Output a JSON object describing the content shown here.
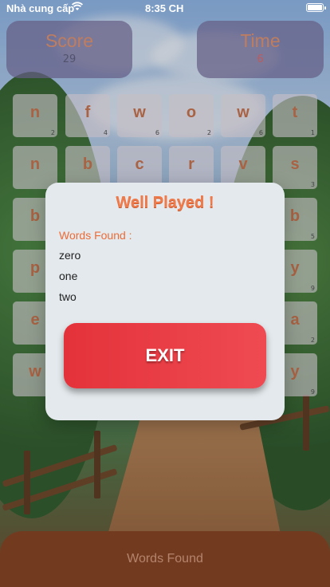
{
  "status_bar": {
    "carrier": "Nhà cung cấp",
    "time": "8:35 CH"
  },
  "score": {
    "label": "Score",
    "value": "29"
  },
  "time": {
    "label": "Time",
    "value": "6"
  },
  "grid": {
    "rows": [
      [
        {
          "l": "n",
          "n": "2"
        },
        {
          "l": "f",
          "n": "4"
        },
        {
          "l": "w",
          "n": "6"
        },
        {
          "l": "o",
          "n": "2"
        },
        {
          "l": "w",
          "n": "6"
        },
        {
          "l": "t",
          "n": "1"
        }
      ],
      [
        {
          "l": "n",
          "n": ""
        },
        {
          "l": "b",
          "n": ""
        },
        {
          "l": "c",
          "n": ""
        },
        {
          "l": "r",
          "n": ""
        },
        {
          "l": "v",
          "n": ""
        },
        {
          "l": "s",
          "n": "3"
        }
      ],
      [
        {
          "l": "b",
          "n": ""
        },
        {
          "l": "",
          "n": ""
        },
        {
          "l": "",
          "n": ""
        },
        {
          "l": "",
          "n": ""
        },
        {
          "l": "",
          "n": ""
        },
        {
          "l": "b",
          "n": "5"
        }
      ],
      [
        {
          "l": "p",
          "n": ""
        },
        {
          "l": "",
          "n": ""
        },
        {
          "l": "",
          "n": ""
        },
        {
          "l": "",
          "n": ""
        },
        {
          "l": "",
          "n": ""
        },
        {
          "l": "y",
          "n": "9"
        }
      ],
      [
        {
          "l": "e",
          "n": ""
        },
        {
          "l": "",
          "n": ""
        },
        {
          "l": "",
          "n": ""
        },
        {
          "l": "",
          "n": ""
        },
        {
          "l": "",
          "n": ""
        },
        {
          "l": "a",
          "n": "2"
        }
      ],
      [
        {
          "l": "w",
          "n": ""
        },
        {
          "l": "",
          "n": ""
        },
        {
          "l": "",
          "n": ""
        },
        {
          "l": "",
          "n": ""
        },
        {
          "l": "",
          "n": ""
        },
        {
          "l": "y",
          "n": "9"
        }
      ]
    ]
  },
  "modal": {
    "title": "Well Played !",
    "words_label": "Words Found :",
    "words": [
      "zero",
      "one",
      "two"
    ],
    "exit_label": "EXIT"
  },
  "bottom_bar": {
    "label": "Words Found"
  }
}
